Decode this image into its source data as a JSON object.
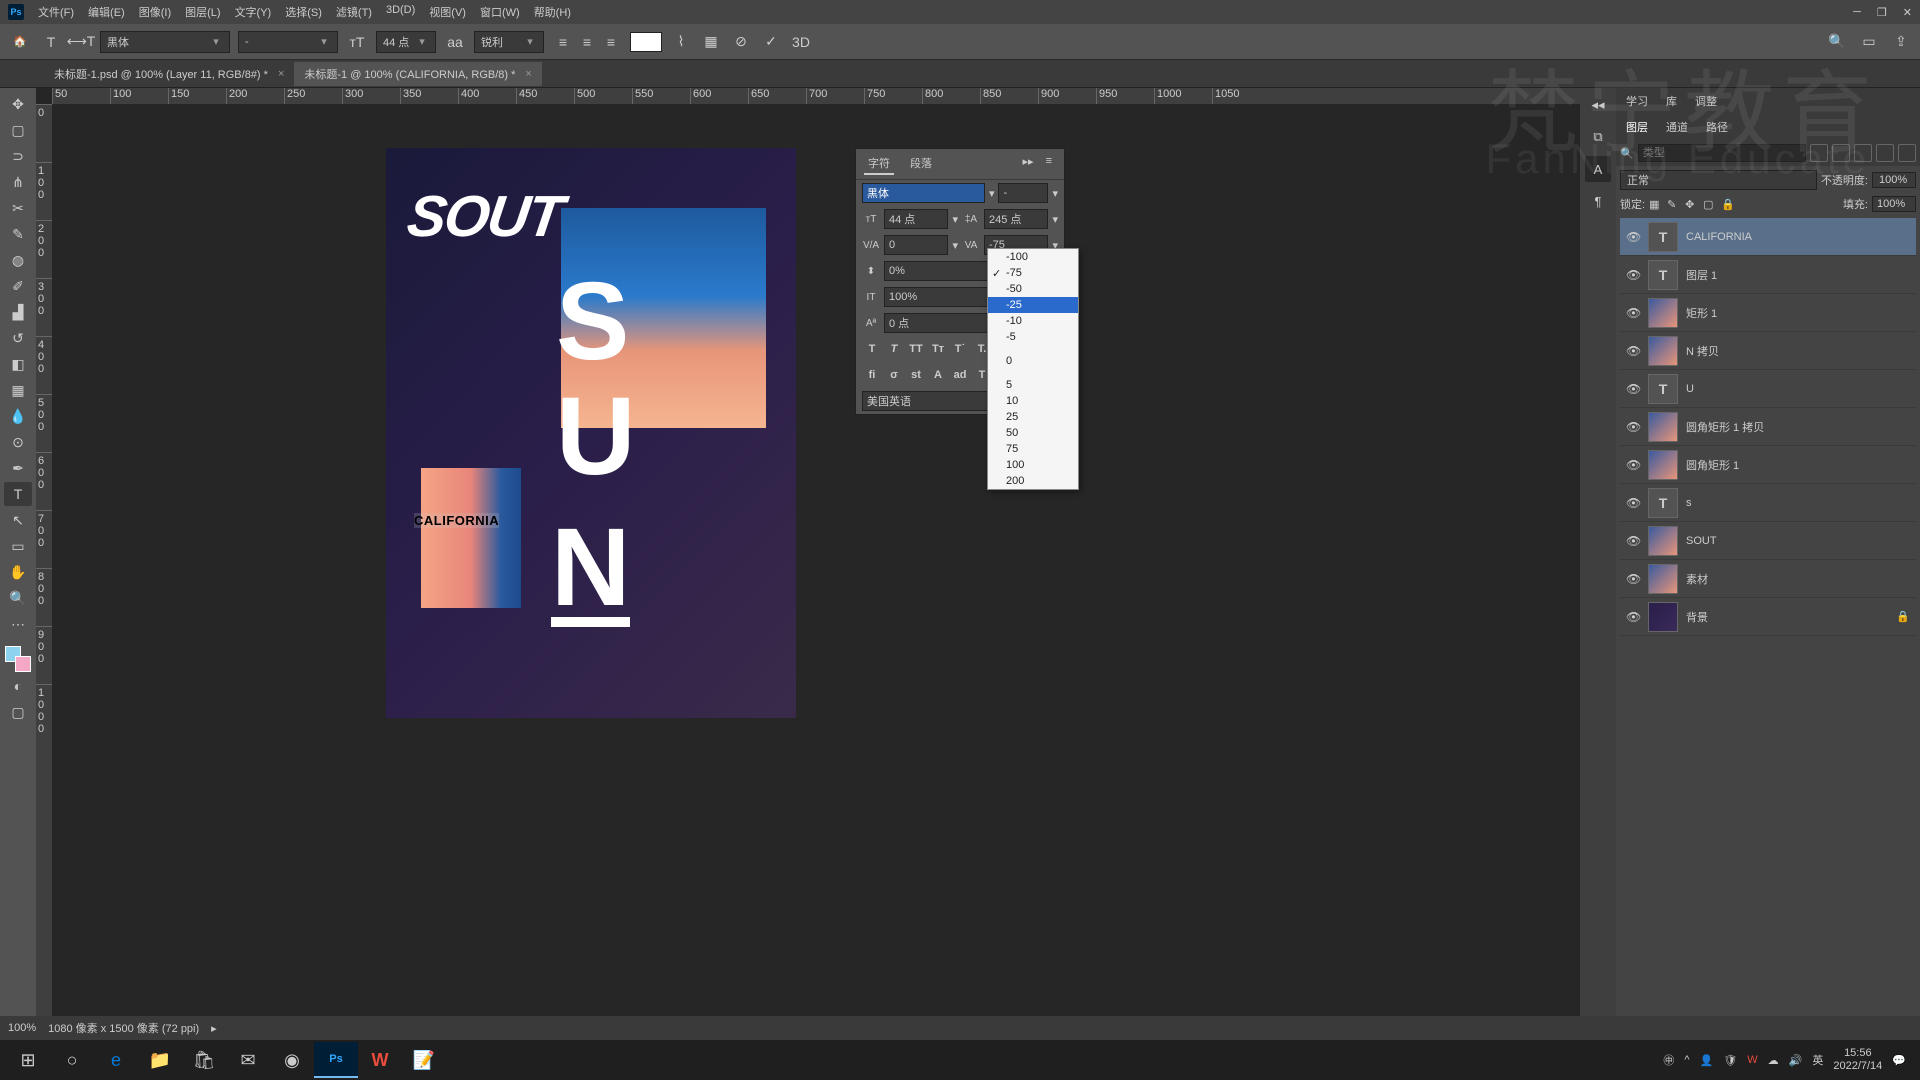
{
  "menu": {
    "items": [
      "文件(F)",
      "编辑(E)",
      "图像(I)",
      "图层(L)",
      "文字(Y)",
      "选择(S)",
      "滤镜(T)",
      "3D(D)",
      "视图(V)",
      "窗口(W)",
      "帮助(H)"
    ]
  },
  "optbar": {
    "font": "黑体",
    "style": "-",
    "size": "44 点",
    "aa": "锐利"
  },
  "tabs": [
    {
      "label": "未标题-1.psd @ 100% (Layer 11, RGB/8#) *",
      "active": false
    },
    {
      "label": "未标题-1 @ 100% (CALIFORNIA, RGB/8) *",
      "active": true
    }
  ],
  "rulerH": [
    "50",
    "100",
    "150",
    "200",
    "250",
    "300",
    "350",
    "400",
    "450",
    "500",
    "550",
    "600",
    "650",
    "700",
    "750",
    "800",
    "850",
    "900",
    "950",
    "1000",
    "1050"
  ],
  "rulerV": [
    "0",
    "1",
    "0",
    "1",
    "0",
    "2",
    "0",
    "3",
    "0",
    "4",
    "0",
    "5",
    "0",
    "6",
    "0"
  ],
  "doc": {
    "sout": "SOUT",
    "s": "S",
    "u": "U",
    "n": "N",
    "cali": "CALIFORNIA"
  },
  "char": {
    "tab1": "字符",
    "tab2": "段落",
    "font": "黑体",
    "style": "-",
    "size": "44 点",
    "leading": "245 点",
    "va": "0",
    "tracking": "-75",
    "pct": "0%",
    "scale": "100%",
    "baseline": "0 点",
    "lang": "美国英语"
  },
  "dropdown": {
    "opts": [
      "-100",
      "-75",
      "-50",
      "-25",
      "-10",
      "-5",
      "",
      "0",
      "",
      "5",
      "10",
      "25",
      "50",
      "75",
      "100",
      "200"
    ],
    "checked": "-75",
    "highlighted": "-25"
  },
  "rtabs1": [
    "学习",
    "库",
    "调整"
  ],
  "rtabs2": [
    "图层",
    "通道",
    "路径"
  ],
  "layerOpts": {
    "blend": "正常",
    "opacity_lbl": "不透明度:",
    "opacity": "100%",
    "lock_lbl": "锁定:",
    "fill_lbl": "填充:",
    "fill": "100%",
    "search": "类型"
  },
  "layers": [
    {
      "name": "CALIFORNIA",
      "type": "t",
      "sel": true
    },
    {
      "name": "图层 1",
      "type": "t"
    },
    {
      "name": "矩形 1",
      "type": "img"
    },
    {
      "name": "N 拷贝",
      "type": "img"
    },
    {
      "name": "U",
      "type": "t"
    },
    {
      "name": "圆角矩形 1 拷贝",
      "type": "img"
    },
    {
      "name": "圆角矩形 1",
      "type": "img"
    },
    {
      "name": "s",
      "type": "t"
    },
    {
      "name": "SOUT",
      "type": "img"
    },
    {
      "name": "素材",
      "type": "img"
    },
    {
      "name": "背景",
      "type": "bg",
      "locked": true
    }
  ],
  "status": {
    "zoom": "100%",
    "info": "1080 像素 x 1500 像素 (72 ppi)"
  },
  "taskbar": {
    "time": "15:56",
    "date": "2022/7/14",
    "ime": "英"
  },
  "watermark": "梵宁教育",
  "watermark2": "FanNing Educate"
}
